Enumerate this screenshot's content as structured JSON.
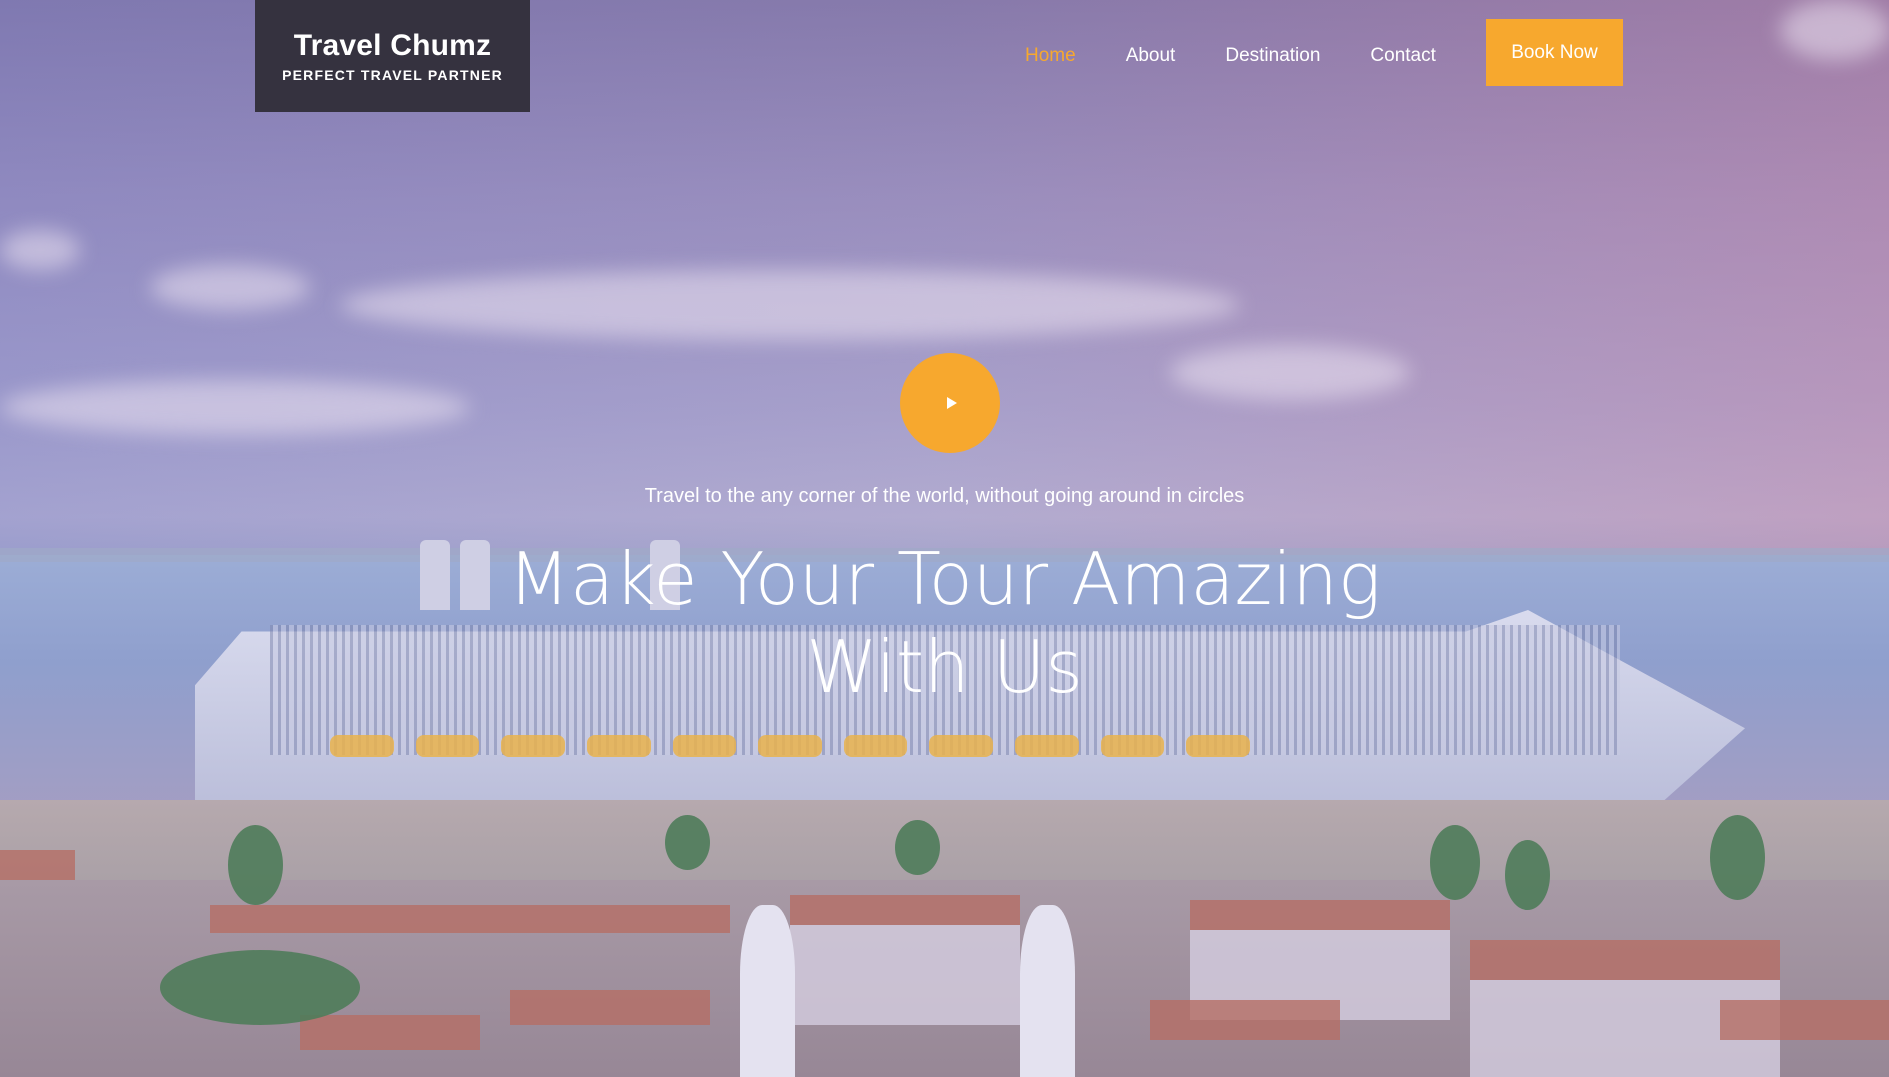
{
  "brand": {
    "title": "Travel Chumz",
    "subtitle": "PERFECT TRAVEL PARTNER"
  },
  "nav": {
    "items": [
      {
        "label": "Home",
        "active": true
      },
      {
        "label": "About",
        "active": false
      },
      {
        "label": "Destination",
        "active": false
      },
      {
        "label": "Contact",
        "active": false
      }
    ],
    "cta_label": "Book Now"
  },
  "hero": {
    "play_icon": "play-icon",
    "subtitle": "Travel to the any corner of the world, without going around in circles",
    "headline_line1": "Make Your Tour Amazing",
    "headline_line2": "With Us"
  },
  "colors": {
    "accent": "#f7a82e",
    "brand_bg": "#35323f",
    "text": "#ffffff"
  }
}
